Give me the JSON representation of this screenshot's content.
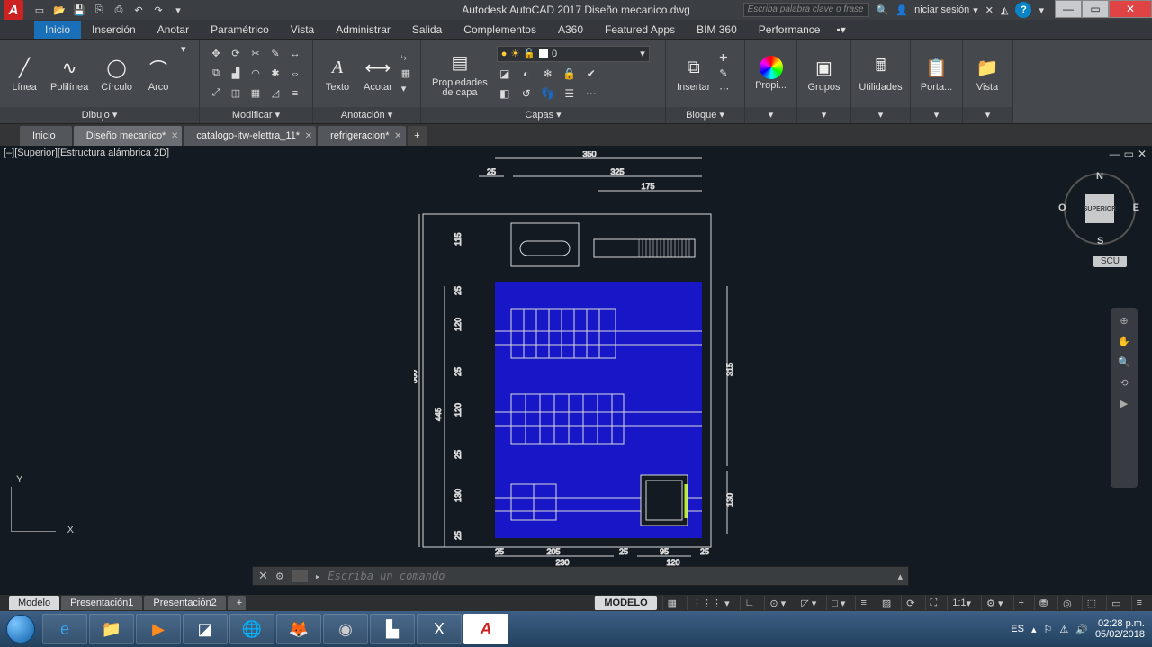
{
  "app": {
    "title": "Autodesk AutoCAD 2017   Diseño mecanico.dwg",
    "logo": "A"
  },
  "qat_icons": [
    "new",
    "open",
    "save",
    "saveas",
    "print",
    "undo",
    "redo"
  ],
  "search": {
    "placeholder": "Escriba palabra clave o frase"
  },
  "login": {
    "label": "Iniciar sesión"
  },
  "menutabs": [
    "Inicio",
    "Inserción",
    "Anotar",
    "Paramétrico",
    "Vista",
    "Administrar",
    "Salida",
    "Complementos",
    "A360",
    "Featured Apps",
    "BIM 360",
    "Performance"
  ],
  "menutab_active": 0,
  "ribbon": {
    "dibujo": {
      "label": "Dibujo ▾",
      "btns": [
        {
          "lbl": "Línea",
          "ic": "╱"
        },
        {
          "lbl": "Polilínea",
          "ic": "∿"
        },
        {
          "lbl": "Círculo",
          "ic": "◯"
        },
        {
          "lbl": "Arco",
          "ic": "⌒"
        }
      ]
    },
    "modificar": {
      "label": "Modificar ▾"
    },
    "anotacion": {
      "label": "Anotación ▾",
      "btns": [
        {
          "lbl": "Texto",
          "ic": "A"
        },
        {
          "lbl": "Acotar",
          "ic": "⟷"
        }
      ]
    },
    "capas": {
      "label": "Capas ▾",
      "prop_label": "Propiedades\nde capa",
      "layer_current": "0"
    },
    "bloque": {
      "label": "Bloque ▾",
      "btns": [
        {
          "lbl": "Insertar",
          "ic": "⧉"
        }
      ]
    },
    "propiedades": {
      "label": "Propi..."
    },
    "grupos": {
      "label": "Grupos"
    },
    "utilidades": {
      "label": "Utilidades"
    },
    "portapapeles": {
      "label": "Porta..."
    },
    "vista": {
      "label": "Vista"
    }
  },
  "doctabs": [
    {
      "label": "Inicio",
      "closable": false
    },
    {
      "label": "Diseño mecanico*",
      "closable": true,
      "active": true
    },
    {
      "label": "catalogo-itw-elettra_11*",
      "closable": true
    },
    {
      "label": "refrigeracion*",
      "closable": true
    }
  ],
  "view_label": "[–][Superior][Estructura alámbrica 2D]",
  "viewcube": {
    "face": "SUPERIOR",
    "n": "N",
    "s": "S",
    "e": "E",
    "w": "O"
  },
  "scu": "SCU",
  "ucs": {
    "x": "X",
    "y": "Y"
  },
  "cmd": {
    "placeholder": "Escriba un comando"
  },
  "modeltabs": [
    "Modelo",
    "Presentación1",
    "Presentación2"
  ],
  "modeltab_active": 0,
  "statusbar": {
    "mode": "MODELO",
    "scale": "1:1"
  },
  "dimensions": {
    "d350": "350",
    "d325": "325",
    "d175": "175",
    "d25": "25",
    "d115": "115",
    "d560": "560",
    "d445": "445",
    "d120": "120",
    "d315": "315",
    "d130": "130",
    "d205": "205",
    "d95": "95",
    "d230": "230"
  },
  "clock": {
    "time": "02:28 p.m.",
    "date": "05/02/2018",
    "lang": "ES"
  }
}
